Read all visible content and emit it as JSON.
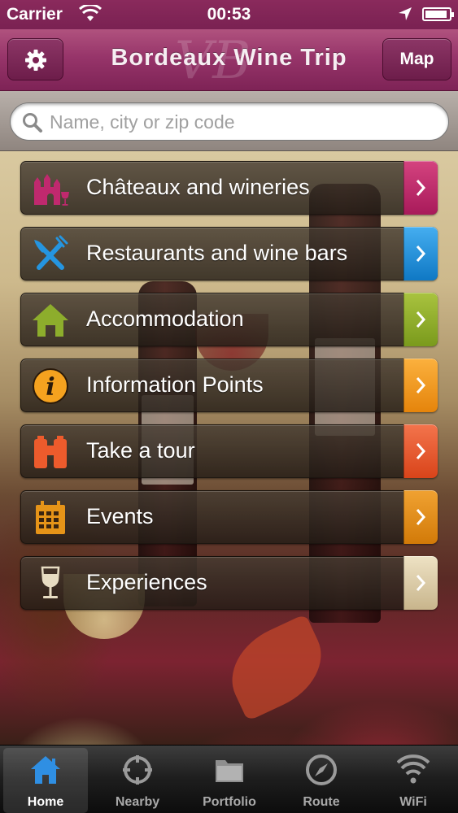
{
  "status_bar": {
    "carrier": "Carrier",
    "time": "00:53"
  },
  "nav": {
    "title": "Bordeaux Wine Trip",
    "monogram": "VB",
    "map_label": "Map",
    "settings_icon": "gear-icon"
  },
  "search": {
    "placeholder": "Name, city or zip code",
    "icon": "search-icon"
  },
  "menu": [
    {
      "label": "Châteaux and wineries",
      "icon": "chateau-icon",
      "accent": "#c0296e"
    },
    {
      "label": "Restaurants and wine bars",
      "icon": "fork-knife-icon",
      "accent": "#1c8fd8"
    },
    {
      "label": "Accommodation",
      "icon": "house-icon",
      "accent": "#8bab2b"
    },
    {
      "label": "Information Points",
      "icon": "info-icon",
      "accent": "#f39a1e"
    },
    {
      "label": "Take a tour",
      "icon": "binoculars-icon",
      "accent": "#ea5a30"
    },
    {
      "label": "Events",
      "icon": "calendar-icon",
      "accent": "#e38c16"
    },
    {
      "label": "Experiences",
      "icon": "wine-glass-icon",
      "accent": "#d8c9a6"
    }
  ],
  "tabs": [
    {
      "label": "Home",
      "icon": "home-icon",
      "active": true
    },
    {
      "label": "Nearby",
      "icon": "crosshair-icon",
      "active": false
    },
    {
      "label": "Portfolio",
      "icon": "folder-icon",
      "active": false
    },
    {
      "label": "Route",
      "icon": "compass-icon",
      "active": false
    },
    {
      "label": "WiFi",
      "icon": "wifi-icon",
      "active": false
    }
  ]
}
